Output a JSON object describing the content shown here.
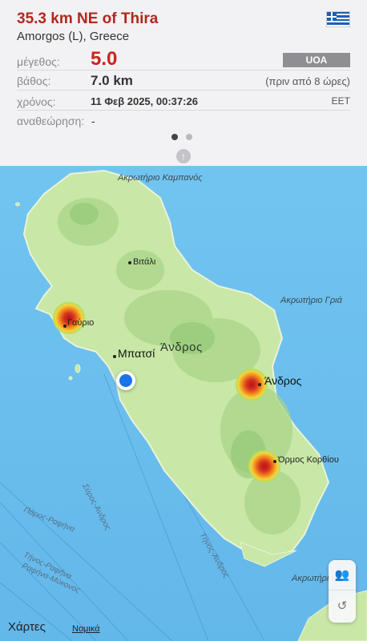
{
  "event": {
    "title": "35.3 km NE of Thira",
    "subtitle": "Amorgos (L), Greece",
    "flag_icon": "greece-flag-icon"
  },
  "details": {
    "magnitude_label": "μέγεθος:",
    "magnitude_value": "5.0",
    "source_badge": "UOA",
    "depth_label": "βάθος:",
    "depth_value": "7.0 km",
    "ago": "(πριν από 8 ώρες)",
    "time_label": "χρόνος:",
    "time_value": "11 Φεβ 2025, 00:37:26",
    "timezone": "EET",
    "revision_label": "αναθεώρηση:",
    "revision_value": "-"
  },
  "pager": {
    "pages": 2,
    "current": 1
  },
  "map": {
    "capes": [
      "Ακρωτήριο Καμπανός",
      "Ακρωτήριο Γριά",
      "Ακρωτήριο"
    ],
    "places": {
      "vitali": "Βιτάλι",
      "gavrio": "Γαύριο",
      "mpatsi": "Μπατσί",
      "island": "Άνδρος",
      "andros_town": "Άνδρος",
      "ormos_korthiou": "Όρμος Κορθίου"
    },
    "routes": [
      "Σύρος-Άνδρος",
      "Πάρος-Ραφήνα",
      "Τήνος-Ραφήνα",
      "Ραφήνα-Μύκονος",
      "Τήνος-Άνδρος"
    ],
    "colors": {
      "sea": "#6ec1ee",
      "land": "#c8e6a4",
      "quake_core": "#b3151b",
      "user_location": "#1a73e8"
    }
  },
  "footer": {
    "brand": "Χάρτες",
    "legal": "Νομικά"
  }
}
